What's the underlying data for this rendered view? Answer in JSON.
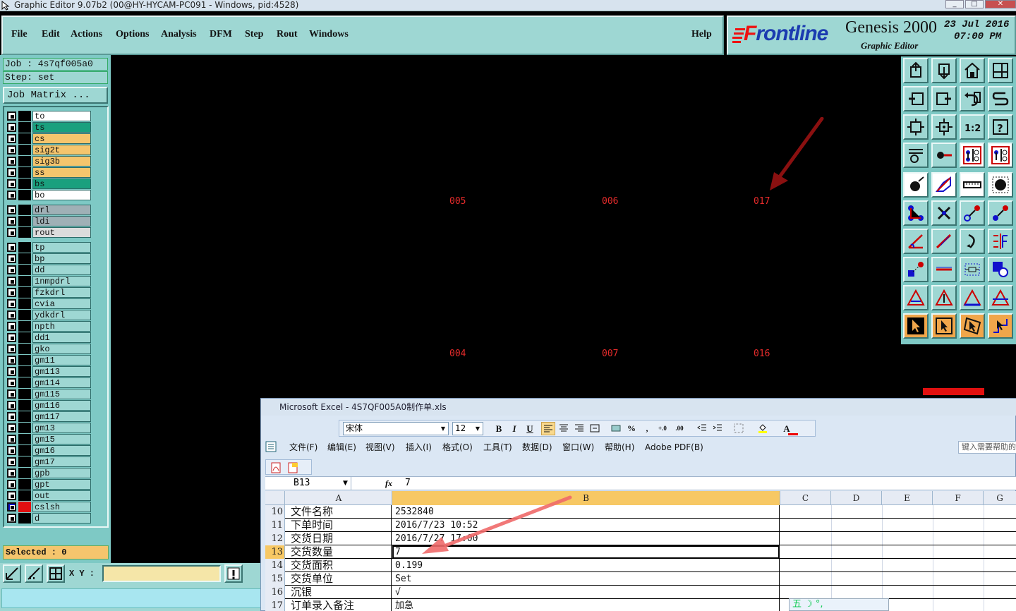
{
  "window": {
    "title": "Graphic Editor 9.07b2 (00@HY-HYCAM-PC091 - Windows, pid:4528)"
  },
  "menu": {
    "file": "File",
    "edit": "Edit",
    "actions": "Actions",
    "options": "Options",
    "analysis": "Analysis",
    "dfm": "DFM",
    "step": "Step",
    "rout": "Rout",
    "windows": "Windows",
    "help": "Help"
  },
  "logo": {
    "brand": "Frontline",
    "product": "Genesis 2000",
    "subtitle": "Graphic Editor",
    "date": "23 Jul 2016",
    "time": "07:00 PM"
  },
  "job": {
    "job_line": "Job : 4s7qf005a0",
    "step_line": "Step: set",
    "job_matrix": "Job Matrix ..."
  },
  "layers": [
    {
      "name": "to",
      "color": "#ffffff"
    },
    {
      "name": "ts",
      "color": "#1aa07e"
    },
    {
      "name": "cs",
      "color": "#f5c56d"
    },
    {
      "name": "sig2t",
      "color": "#f5c56d"
    },
    {
      "name": "sig3b",
      "color": "#f5c56d"
    },
    {
      "name": "ss",
      "color": "#f5c56d"
    },
    {
      "name": "bs",
      "color": "#1aa07e"
    },
    {
      "name": "bo",
      "color": "#ffffff"
    },
    {
      "name": "drl",
      "color": "#9fb0b6"
    },
    {
      "name": "ldi",
      "color": "#9fb0b6"
    },
    {
      "name": "rout",
      "color": "#dcdcdc"
    },
    {
      "name": "tp",
      "color": "#9ed7d3"
    },
    {
      "name": "bp",
      "color": "#9ed7d3"
    },
    {
      "name": "dd",
      "color": "#9ed7d3"
    },
    {
      "name": "1nmpdrl",
      "color": "#9ed7d3"
    },
    {
      "name": "fzkdrl",
      "color": "#9ed7d3"
    },
    {
      "name": "cvia",
      "color": "#9ed7d3"
    },
    {
      "name": "ydkdrl",
      "color": "#9ed7d3"
    },
    {
      "name": "npth",
      "color": "#9ed7d3"
    },
    {
      "name": "dd1",
      "color": "#9ed7d3"
    },
    {
      "name": "gko",
      "color": "#9ed7d3"
    },
    {
      "name": "gm11",
      "color": "#9ed7d3"
    },
    {
      "name": "gm113",
      "color": "#9ed7d3"
    },
    {
      "name": "gm114",
      "color": "#9ed7d3"
    },
    {
      "name": "gm115",
      "color": "#9ed7d3"
    },
    {
      "name": "gm116",
      "color": "#9ed7d3"
    },
    {
      "name": "gm117",
      "color": "#9ed7d3"
    },
    {
      "name": "gm13",
      "color": "#9ed7d3"
    },
    {
      "name": "gm15",
      "color": "#9ed7d3"
    },
    {
      "name": "gm16",
      "color": "#9ed7d3"
    },
    {
      "name": "gm17",
      "color": "#9ed7d3"
    },
    {
      "name": "gpb",
      "color": "#9ed7d3"
    },
    {
      "name": "gpt",
      "color": "#9ed7d3"
    },
    {
      "name": "out",
      "color": "#9ed7d3"
    },
    {
      "name": "cslsh",
      "color": "#9ed7d3"
    },
    {
      "name": "d",
      "color": "#9ed7d3"
    }
  ],
  "status": {
    "selected": "Selected : 0",
    "xy_label": "X Y :"
  },
  "canvas": {
    "steps": [
      "005",
      "006",
      "017",
      "004",
      "007",
      "016"
    ]
  },
  "excel": {
    "title": "Microsoft Excel - 4S7QF005A0制作单.xls",
    "font_name": "宋体",
    "font_size": "12",
    "menu": [
      "文件(F)",
      "编辑(E)",
      "视图(V)",
      "插入(I)",
      "格式(O)",
      "工具(T)",
      "数据(D)",
      "窗口(W)",
      "帮助(H)",
      "Adobe PDF(B)"
    ],
    "help_placeholder": "键入需要帮助的问题",
    "name_box": "B13",
    "formula_value": "7",
    "columns": [
      "A",
      "B",
      "C",
      "D",
      "E",
      "F",
      "G"
    ],
    "rows": [
      {
        "num": "10",
        "a": "文件名称",
        "b": "2532840"
      },
      {
        "num": "11",
        "a": "下单时间",
        "b": "2016/7/23 10:52"
      },
      {
        "num": "12",
        "a": "交货日期",
        "b": "2016/7/27 17:00"
      },
      {
        "num": "13",
        "a": "交货数量",
        "b": "7"
      },
      {
        "num": "14",
        "a": "交货面积",
        "b": "0.199"
      },
      {
        "num": "15",
        "a": "交货单位",
        "b": "Set"
      },
      {
        "num": "16",
        "a": "沉银",
        "b": "√"
      },
      {
        "num": "17",
        "a": "订单录入备注",
        "b": "加急"
      }
    ],
    "ime": "五 ☽ °,"
  }
}
